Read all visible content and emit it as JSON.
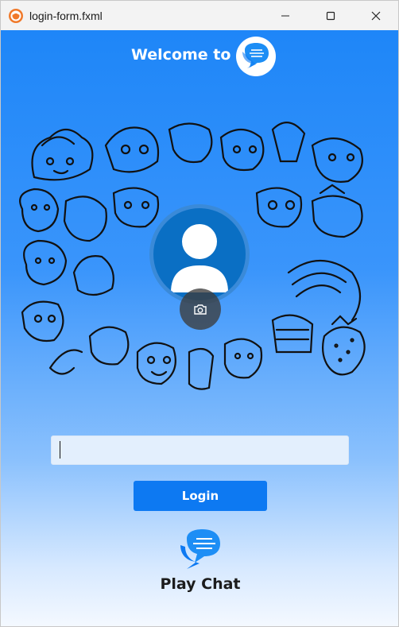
{
  "window": {
    "title": "login-form.fxml",
    "controls": {
      "minimize": "minimize",
      "maximize": "maximize",
      "close": "close"
    }
  },
  "header": {
    "welcome": "Welcome to",
    "logo_icon": "chat-bubbles-icon"
  },
  "illustration": {
    "icon": "doodle-illustration"
  },
  "avatar": {
    "icon": "user-silhouette-icon",
    "camera_icon": "camera-icon"
  },
  "form": {
    "username_value": "",
    "username_placeholder": "",
    "login_label": "Login"
  },
  "footer": {
    "app_name": "Play Chat",
    "logo_icon": "chat-bubbles-icon"
  },
  "colors": {
    "primary": "#0d79f2",
    "background_top": "#1e86f8",
    "background_bottom": "#f5f9ff",
    "avatar": "#0a6fc4",
    "text_dark": "#1c1c1c"
  }
}
